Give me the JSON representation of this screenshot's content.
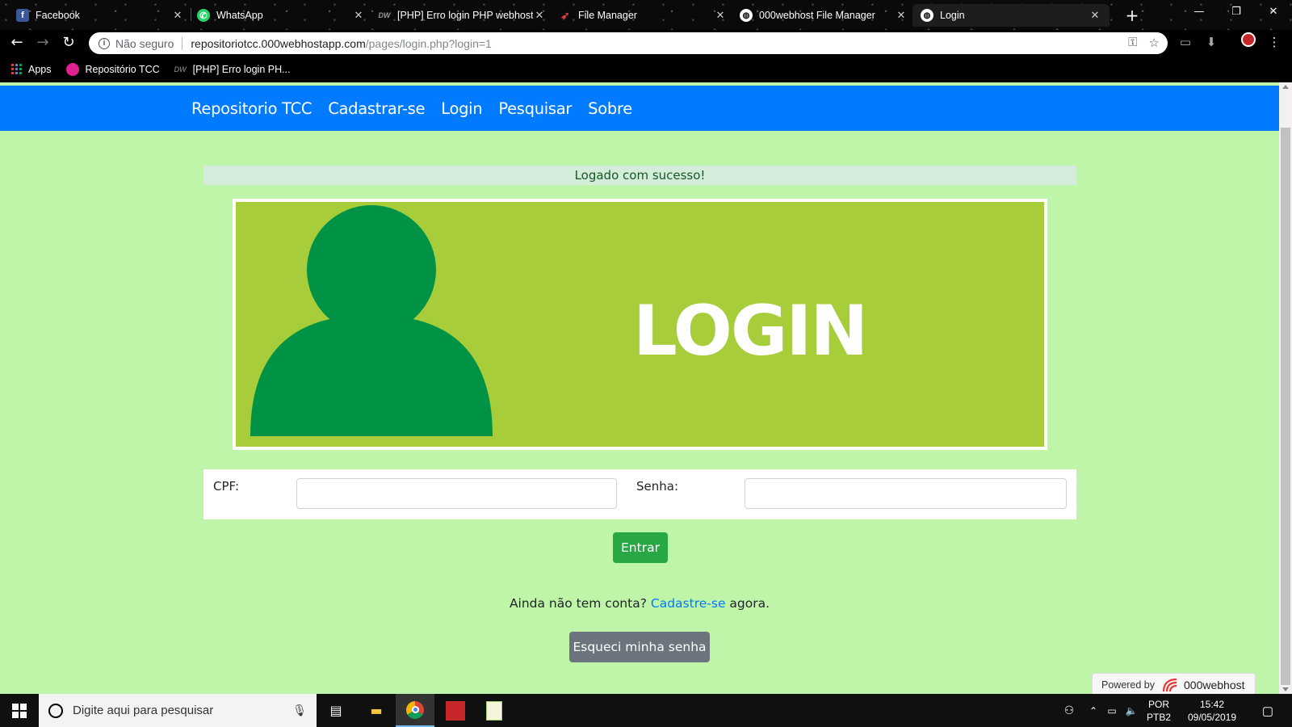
{
  "browser": {
    "tabs": [
      {
        "label": "Facebook",
        "icon": "facebook-icon"
      },
      {
        "label": "WhatsApp",
        "icon": "whatsapp-icon"
      },
      {
        "label": "[PHP] Erro login PHP webhost",
        "icon": "dw-icon"
      },
      {
        "label": "File Manager",
        "icon": "file-manager-icon"
      },
      {
        "label": "000webhost File Manager",
        "icon": "globe-icon"
      },
      {
        "label": "Login",
        "icon": "globe-icon"
      }
    ],
    "address": {
      "security_label": "Não seguro",
      "host": "repositoriotcc.000webhostapp.com",
      "path": "/pages/login.php?login=1"
    },
    "bookmarks": [
      {
        "label": "Apps",
        "icon": "apps-grid-icon"
      },
      {
        "label": "Repositório TCC",
        "icon": "bookmark-site-icon"
      },
      {
        "label": "[PHP] Erro login PH...",
        "icon": "dw-icon"
      }
    ]
  },
  "nav": {
    "brand": "Repositorio TCC",
    "links": [
      "Cadastrar-se",
      "Login",
      "Pesquisar",
      "Sobre"
    ]
  },
  "alert": {
    "message": "Logado com sucesso!",
    "color": "#155724",
    "background": "#d4edda"
  },
  "banner": {
    "title": "LOGIN",
    "background": "#a7ce3a",
    "figure_color": "#009245"
  },
  "form": {
    "cpf_label": "CPF:",
    "cpf_value": "",
    "senha_label": "Senha:",
    "senha_value": "",
    "submit_label": "Entrar",
    "submit_color": "#28a745"
  },
  "signup": {
    "prefix": "Ainda não tem conta?",
    "link": "Cadastre-se",
    "suffix": "agora."
  },
  "forgot": {
    "label": "Esqueci minha senha",
    "color": "#6c757d"
  },
  "powered": {
    "prefix": "Powered by",
    "brand": "000webhost"
  },
  "page": {
    "background": "#bff5a8",
    "navbar_color": "#007bff"
  },
  "taskbar": {
    "search_placeholder": "Digite aqui para pesquisar",
    "lang_top": "POR",
    "lang_bottom": "PTB2",
    "time": "15:42",
    "date": "09/05/2019"
  }
}
